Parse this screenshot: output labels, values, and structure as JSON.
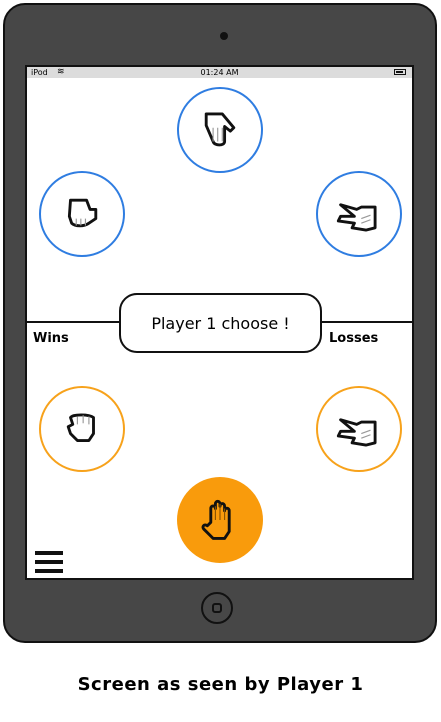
{
  "status_bar": {
    "device": "iPod",
    "time": "01:24 AM"
  },
  "opponent_choices": [
    {
      "name": "paper"
    },
    {
      "name": "rock"
    },
    {
      "name": "scissors"
    }
  ],
  "player_choices": [
    {
      "name": "rock"
    },
    {
      "name": "scissors"
    },
    {
      "name": "paper",
      "selected": true
    }
  ],
  "prompt": "Player 1 choose !",
  "wins_label": "Wins",
  "losses_label": "Losses",
  "caption": "Screen as seen by Player 1",
  "colors": {
    "opponent": "#2f7de1",
    "player": "#f7a21b",
    "selected": "#f99b0c"
  }
}
